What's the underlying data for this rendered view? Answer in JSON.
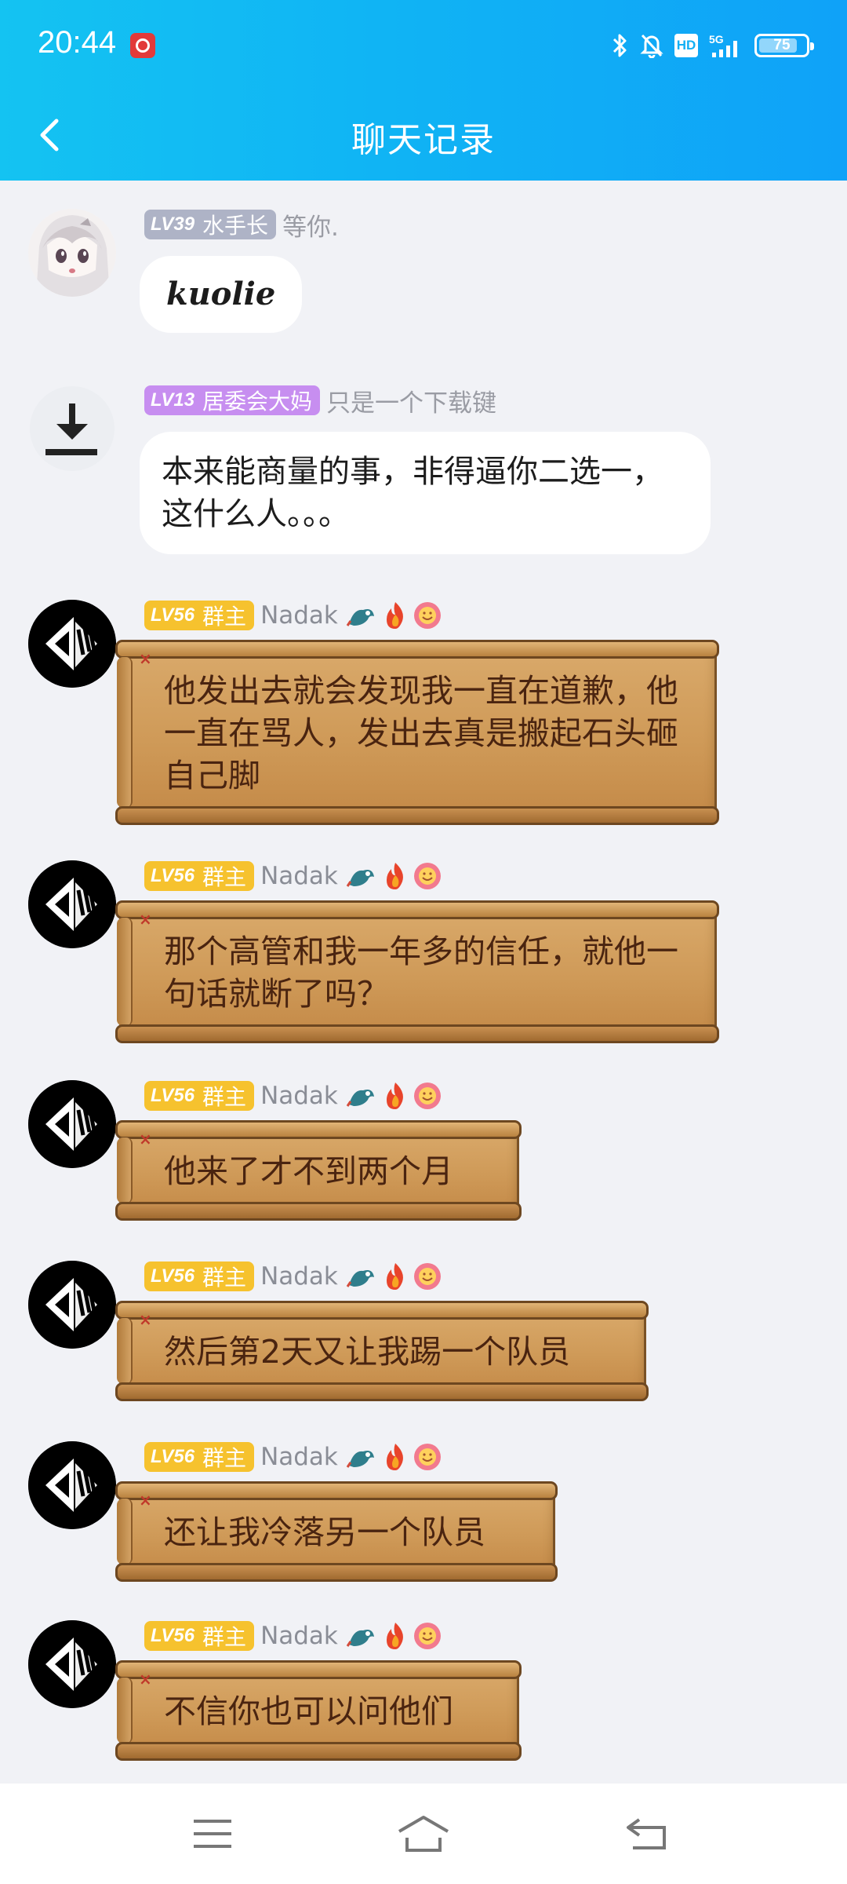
{
  "status": {
    "time": "20:44",
    "network": "5G",
    "hd": "HD",
    "battery": "75"
  },
  "header": {
    "title": "聊天记录"
  },
  "colors": {
    "header_start": "#14c3f2",
    "header_end": "#0fa2f8",
    "level_gray": "#aeb3c6",
    "level_purple": "#c78ef0",
    "level_gold": "#f6c22e",
    "scroll_paper": "#d4a15f"
  },
  "messages": [
    {
      "level": "LV39",
      "title": "水手长",
      "nick": "等你.",
      "text": "kuolie",
      "style": "white",
      "badge": "gray",
      "avatar": "anime-girl-avatar"
    },
    {
      "level": "LV13",
      "title": "居委会大妈",
      "nick": "只是一个下载键",
      "text": "本来能商量的事，非得逼你二选一，这什么人。。。",
      "style": "white",
      "badge": "purple",
      "avatar": "download-avatar"
    },
    {
      "level": "LV56",
      "title": "群主",
      "nick": "Nadak",
      "text": "他发出去就会发现我一直在道歉，他一直在骂人，发出去真是搬起石头砸自己脚",
      "style": "scroll",
      "badge": "gold"
    },
    {
      "level": "LV56",
      "title": "群主",
      "nick": "Nadak",
      "text": "那个高管和我一年多的信任，就他一句话就断了吗？",
      "style": "scroll",
      "badge": "gold"
    },
    {
      "level": "LV56",
      "title": "群主",
      "nick": "Nadak",
      "text": "他来了才不到两个月",
      "style": "scroll",
      "badge": "gold"
    },
    {
      "level": "LV56",
      "title": "群主",
      "nick": "Nadak",
      "text": "然后第2天又让我踢一个队员",
      "style": "scroll",
      "badge": "gold"
    },
    {
      "level": "LV56",
      "title": "群主",
      "nick": "Nadak",
      "text": "还让我冷落另一个队员",
      "style": "scroll",
      "badge": "gold"
    },
    {
      "level": "LV56",
      "title": "群主",
      "nick": "Nadak",
      "text": "不信你也可以问他们",
      "style": "scroll",
      "badge": "gold"
    }
  ],
  "icons": {
    "nick_decor": [
      "dragon-icon",
      "fire-icon",
      "smile-flower-icon"
    ]
  },
  "system_nav": [
    "menu-icon",
    "home-icon",
    "back-icon"
  ]
}
